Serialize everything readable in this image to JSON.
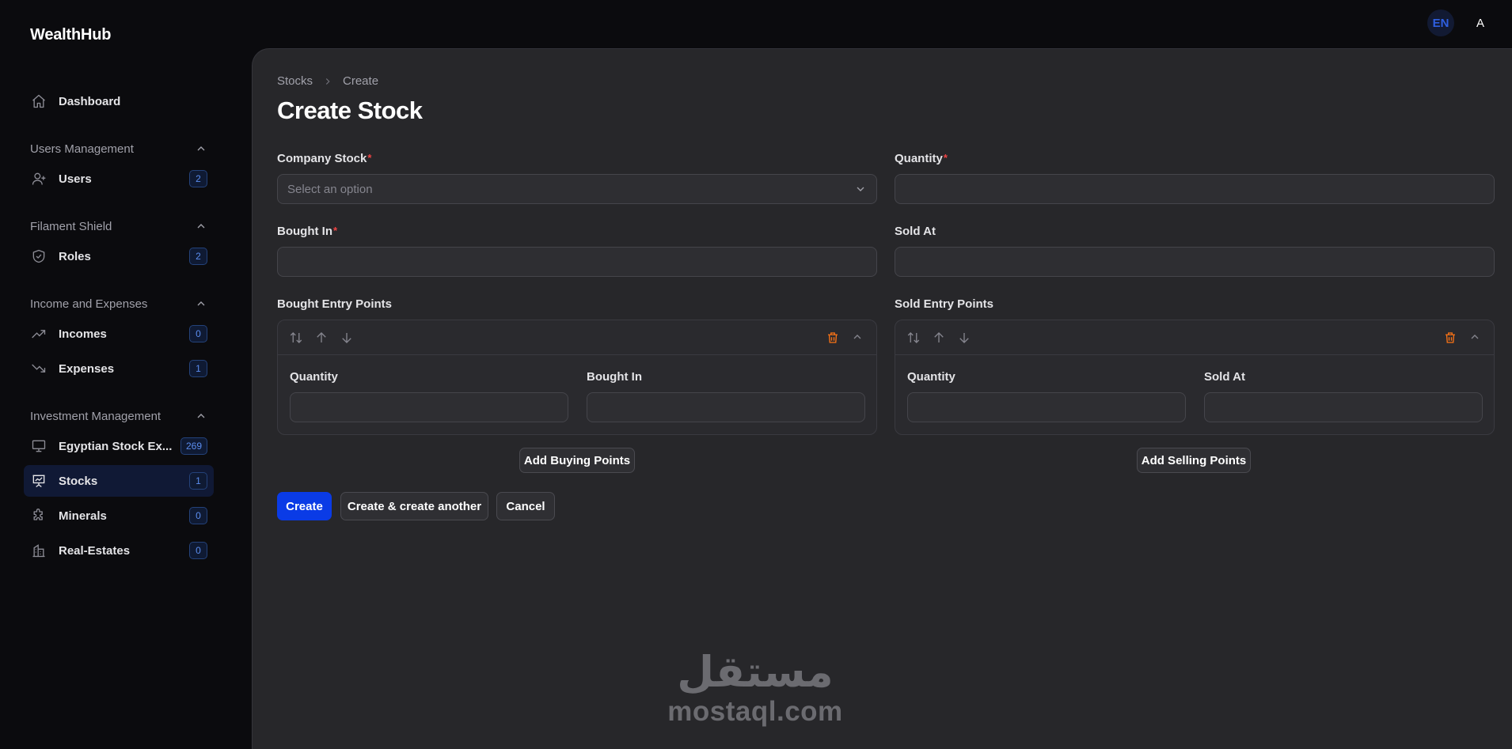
{
  "app": {
    "brand": "WealthHub"
  },
  "topbar": {
    "lang": "EN",
    "avatar_initial": "A"
  },
  "sidebar": {
    "dashboard": {
      "label": "Dashboard"
    },
    "groups": [
      {
        "title": "Users Management",
        "items": [
          {
            "label": "Users",
            "count": "2",
            "icon": "user-plus-icon"
          }
        ]
      },
      {
        "title": "Filament Shield",
        "items": [
          {
            "label": "Roles",
            "count": "2",
            "icon": "shield-icon"
          }
        ]
      },
      {
        "title": "Income and Expenses",
        "items": [
          {
            "label": "Incomes",
            "count": "0",
            "icon": "trending-up-icon"
          },
          {
            "label": "Expenses",
            "count": "1",
            "icon": "trending-down-icon"
          }
        ]
      },
      {
        "title": "Investment Management",
        "items": [
          {
            "label": "Egyptian Stock Ex...",
            "count": "269",
            "icon": "monitor-icon"
          },
          {
            "label": "Stocks",
            "count": "1",
            "icon": "presentation-chart-icon",
            "active": true
          },
          {
            "label": "Minerals",
            "count": "0",
            "icon": "puzzle-icon"
          },
          {
            "label": "Real-Estates",
            "count": "0",
            "icon": "building-icon"
          }
        ]
      }
    ]
  },
  "breadcrumb": {
    "parent": "Stocks",
    "current": "Create"
  },
  "page": {
    "title": "Create Stock"
  },
  "form": {
    "company_stock": {
      "label": "Company Stock",
      "placeholder": "Select an option"
    },
    "quantity": {
      "label": "Quantity"
    },
    "bought_in": {
      "label": "Bought In"
    },
    "sold_at": {
      "label": "Sold At"
    },
    "bought_entry_points": {
      "label": "Bought Entry Points",
      "quantity_label": "Quantity",
      "bought_in_label": "Bought In",
      "add_label": "Add Buying Points"
    },
    "sold_entry_points": {
      "label": "Sold Entry Points",
      "quantity_label": "Quantity",
      "sold_at_label": "Sold At",
      "add_label": "Add Selling Points"
    },
    "required_mark": "*"
  },
  "actions": {
    "create": "Create",
    "create_another": "Create & create another",
    "cancel": "Cancel"
  },
  "watermark": {
    "arabic": "مستقل",
    "latin": "mostaql.com"
  },
  "colors": {
    "primary": "#0a3be6",
    "danger": "#f97316",
    "badge": "#5b8def"
  }
}
